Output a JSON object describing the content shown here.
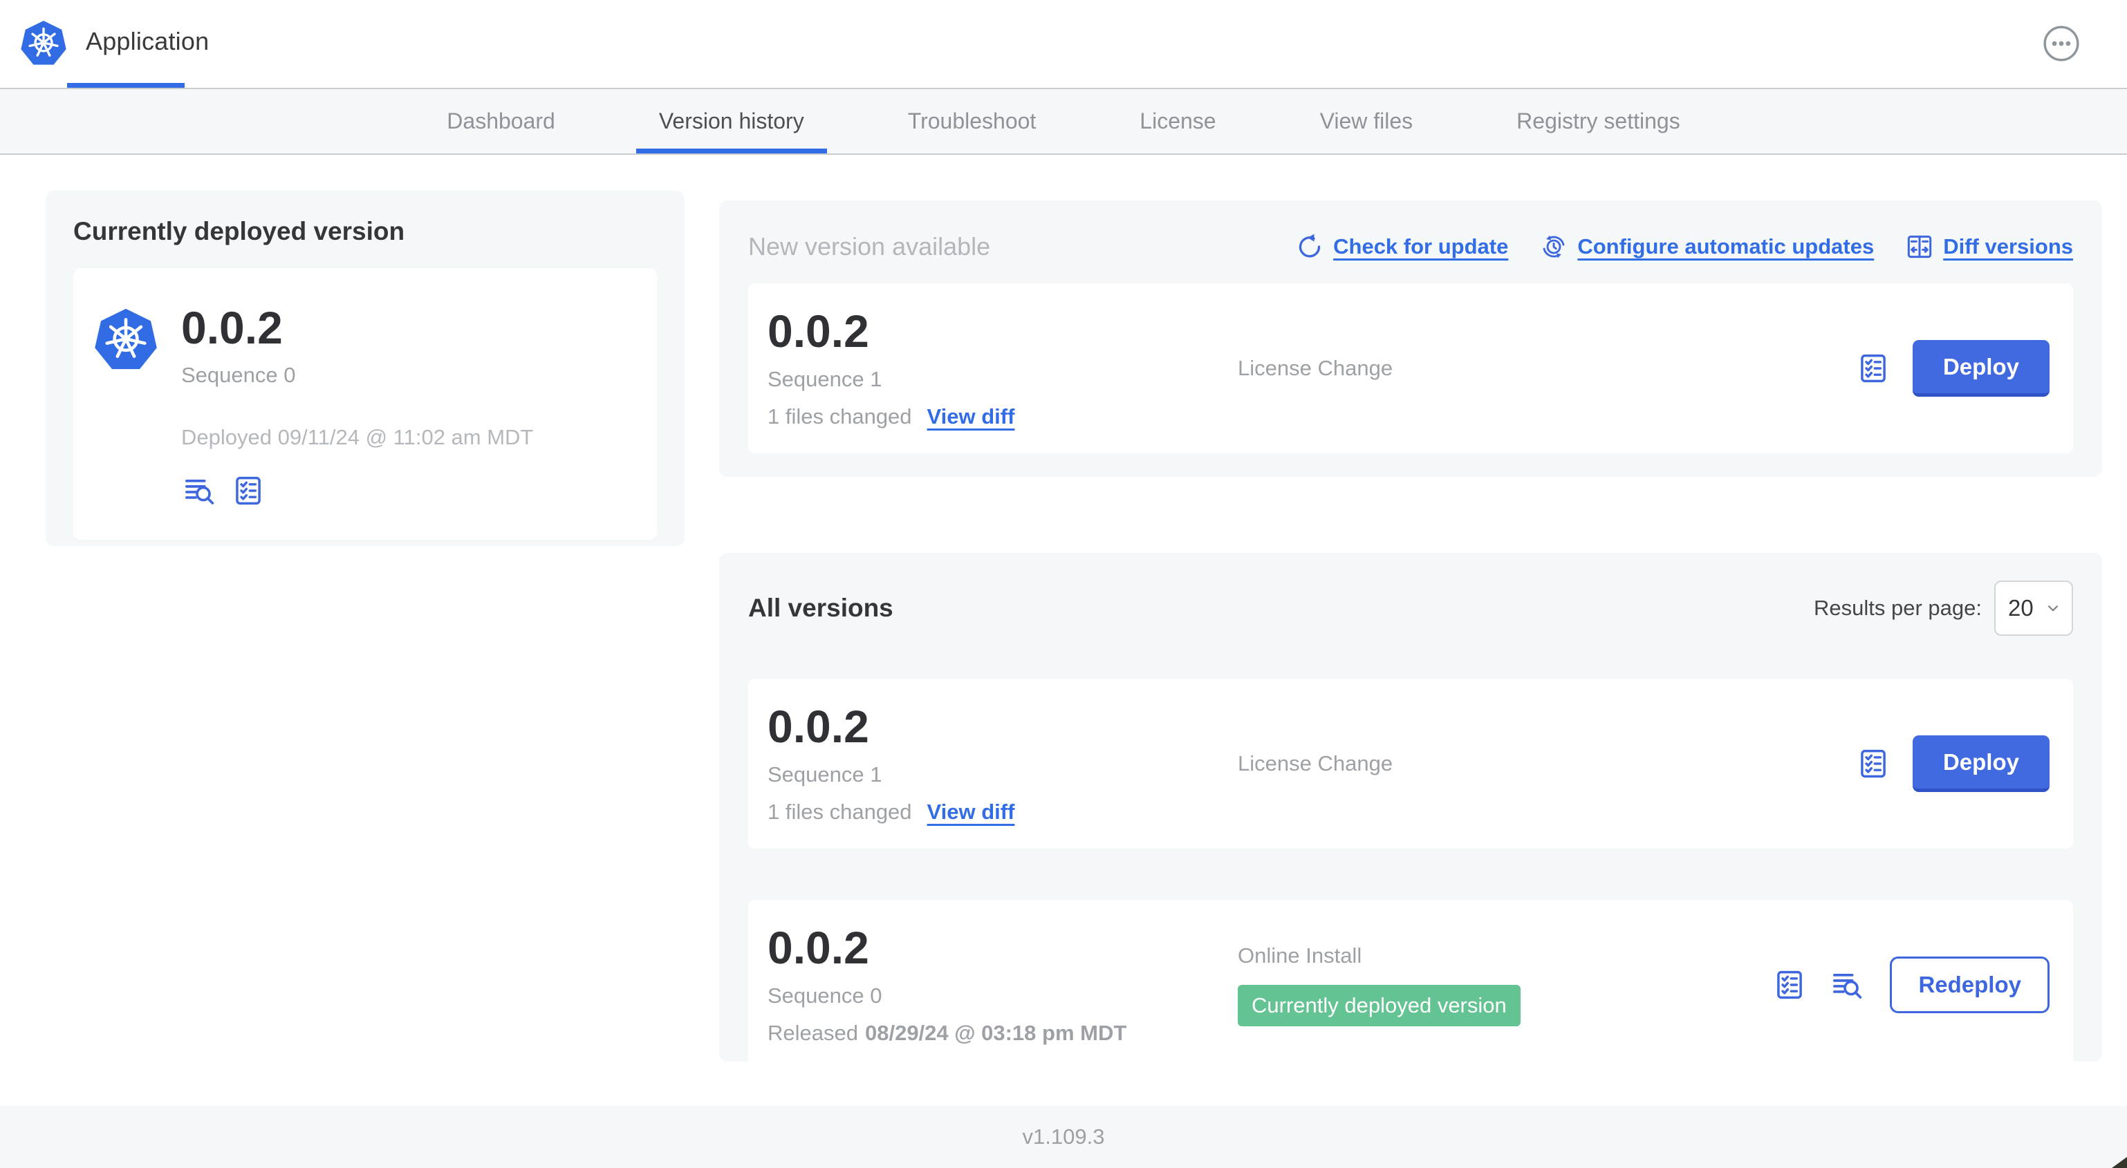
{
  "app": {
    "title": "Application",
    "footer_version": "v1.109.3"
  },
  "nav": {
    "tabs": [
      {
        "label": "Dashboard",
        "active": false
      },
      {
        "label": "Version history",
        "active": true
      },
      {
        "label": "Troubleshoot",
        "active": false
      },
      {
        "label": "License",
        "active": false
      },
      {
        "label": "View files",
        "active": false
      },
      {
        "label": "Registry settings",
        "active": false
      }
    ]
  },
  "deployed_panel": {
    "title": "Currently deployed version",
    "version": "0.0.2",
    "sequence": "Sequence 0",
    "deployed_timestamp": "Deployed 09/11/24 @ 11:02 am MDT",
    "icons": [
      "deploy-logs-icon",
      "preflight-checks-icon"
    ]
  },
  "new_version_section": {
    "title": "New version available",
    "actions": [
      {
        "label": "Check for update",
        "icon": "refresh-icon"
      },
      {
        "label": "Configure automatic updates",
        "icon": "auto-update-clock-icon"
      },
      {
        "label": "Diff versions",
        "icon": "diff-icon"
      }
    ],
    "card": {
      "version": "0.0.2",
      "sequence": "Sequence 1",
      "files_changed": "1 files changed",
      "view_diff_label": "View diff",
      "status": "License Change",
      "button_label": "Deploy",
      "icons": [
        "preflight-checks-icon"
      ]
    }
  },
  "all_versions_section": {
    "title": "All versions",
    "results_per_page_label": "Results per page:",
    "results_per_page_value": "20",
    "rows": [
      {
        "version": "0.0.2",
        "sequence": "Sequence 1",
        "files_changed": "1 files changed",
        "view_diff_label": "View diff",
        "status": "License Change",
        "button_label": "Deploy",
        "icons": [
          "preflight-checks-icon"
        ]
      },
      {
        "version": "0.0.2",
        "sequence": "Sequence 0",
        "released_prefix": "Released",
        "released_date": "08/29/24 @ 03:18 pm MDT",
        "status": "Online Install",
        "badge": "Currently deployed version",
        "button_label": "Redeploy",
        "icons": [
          "preflight-checks-icon",
          "deploy-logs-icon"
        ]
      }
    ]
  },
  "colors": {
    "accent_blue": "#326de6",
    "button_blue": "#4169e0",
    "badge_green": "#63c392",
    "section_bg": "#f5f8f9",
    "text_dark": "#37393b",
    "text_muted": "#9da1a5",
    "text_light": "#b4b8bc"
  }
}
